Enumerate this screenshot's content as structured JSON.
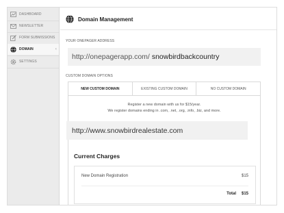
{
  "sidebar": {
    "items": [
      {
        "label": "DASHBOARD",
        "icon": "dashboard-icon",
        "active": false
      },
      {
        "label": "NEWSLETTER",
        "icon": "envelope-icon",
        "active": false
      },
      {
        "label": "FORM SUBMISSIONS",
        "icon": "edit-form-icon",
        "active": false
      },
      {
        "label": "DOMAIN",
        "icon": "globe-icon",
        "active": true
      },
      {
        "label": "SETTINGS",
        "icon": "gear-icon",
        "active": false
      }
    ]
  },
  "header": {
    "title": "Domain Management"
  },
  "onepager": {
    "label": "YOUR ONEPAGER ADDRESS",
    "prefix": "http://onepagerapp.com/",
    "subdomain": "snowbirdbackcountry"
  },
  "custom": {
    "label": "CUSTOM DOMAIN OPTIONS",
    "tabs": [
      "NEW CUSTOM DOMAIN",
      "EXISTING CUSTOM DOMAIN",
      "NO CUSTOM DOMAIN"
    ],
    "note_line1": "Register a new domain with us for $15/year.",
    "note_line2": "We register domains ending in .com, .net, .org, .info, .biz, and more.",
    "domain_value": "http://www.snowbirdrealestate.com"
  },
  "charges": {
    "title": "Current Charges",
    "item_label": "New Domain Registration",
    "item_price": "$15",
    "total_label": "Total",
    "total_price": "$15"
  },
  "colors": {
    "accent": "#222222",
    "sidebar_bg": "#ebebeb",
    "field_bg": "#f1f1f1"
  }
}
